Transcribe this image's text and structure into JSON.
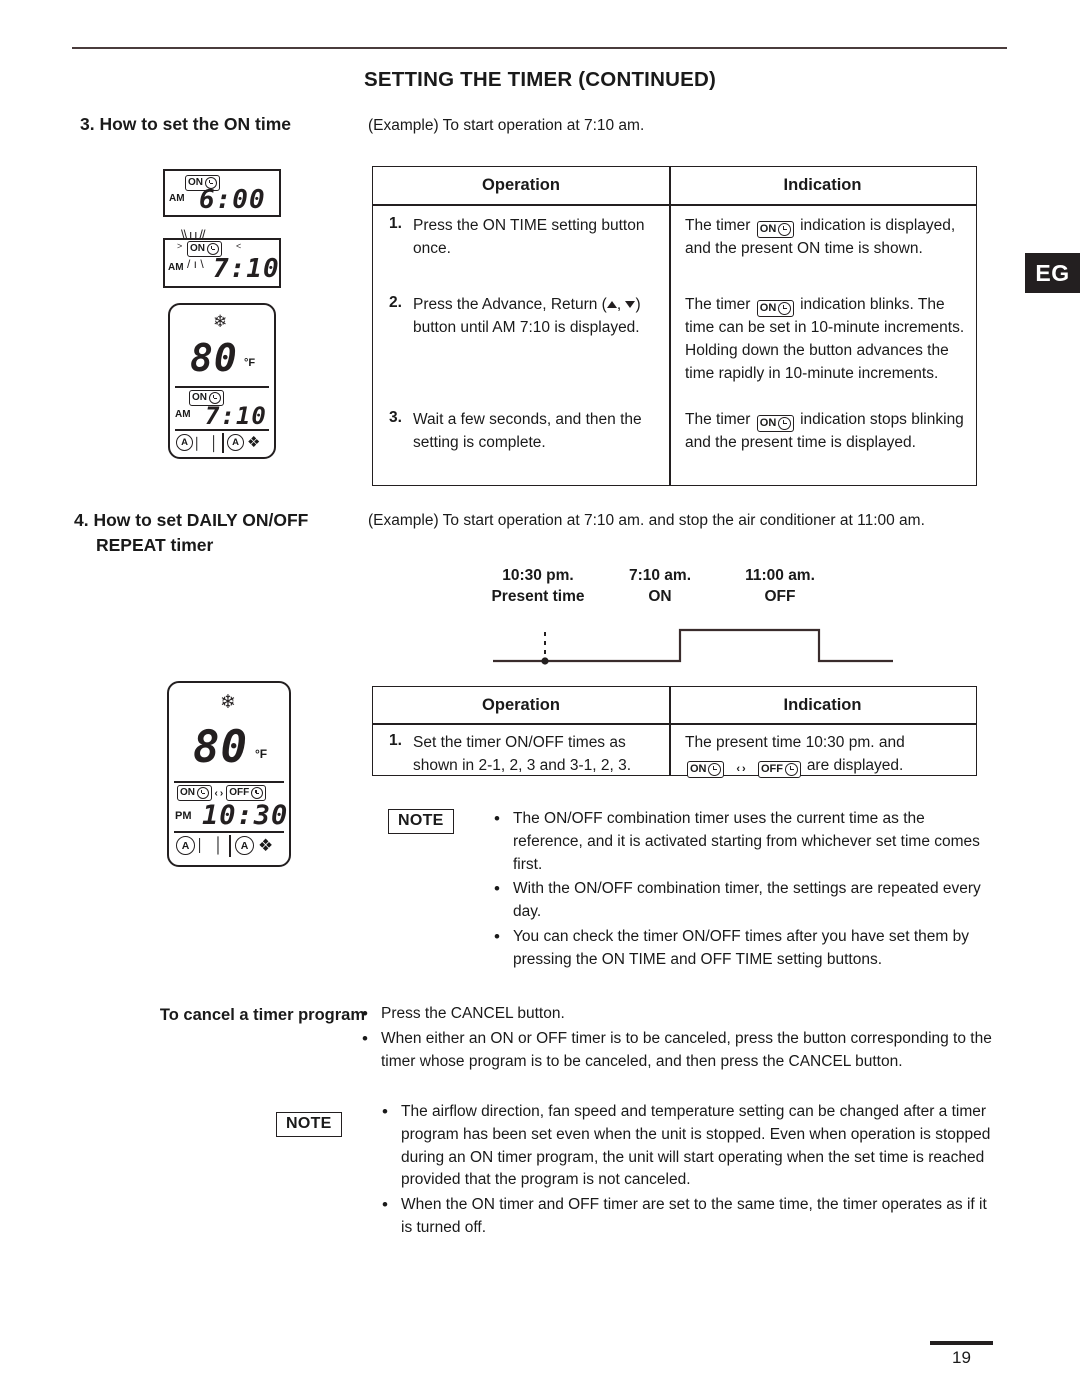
{
  "header": {
    "title": "SETTING THE TIMER (CONTINUED)",
    "edition_tab": "EG"
  },
  "footer": {
    "page_number": "19"
  },
  "section3": {
    "heading": "3. How to set the ON time",
    "example": "(Example) To start operation at 7:10 am.",
    "table": {
      "columns": [
        "Operation",
        "Indication"
      ],
      "rows": [
        {
          "number": "1.",
          "operation": "Press the ON TIME setting button once.",
          "indication_pre": "The timer",
          "indication_icon": "on-timer-icon",
          "indication_post": "indication is displayed, and the present ON time is shown."
        },
        {
          "number": "2.",
          "operation_pre": "Press the Advance, Return (",
          "operation_mid": ",",
          "operation_post": ") button until AM 7:10 is displayed.",
          "indication_pre": "The timer",
          "indication_icon": "on-timer-icon",
          "indication_post": "indication blinks. The time can be set in 10-minute increments. Holding down the button advances the time rapidly in 10-minute increments."
        },
        {
          "number": "3.",
          "operation": "Wait a few seconds, and then the setting is complete.",
          "indication_pre": "The timer",
          "indication_icon": "on-timer-icon",
          "indication_post": "indication stops blinking and the present time is displayed."
        }
      ]
    },
    "lcd_displays": [
      {
        "ampm": "AM",
        "time": "6:00",
        "badge": "ON",
        "blinking": false
      },
      {
        "ampm": "AM",
        "time": "7:10",
        "badge": "ON",
        "blinking": true
      },
      {
        "ampm": "AM",
        "time": "7:10",
        "badge": "ON",
        "temperature": "80",
        "unit": "°F",
        "mode_icon": "snowflake-icon",
        "louver": "auto",
        "fan": "auto"
      }
    ]
  },
  "section4": {
    "heading_line1": "4. How to set DAILY ON/OFF",
    "heading_line2": "REPEAT timer",
    "example": "(Example) To start operation at 7:10 am. and stop the air conditioner at 11:00 am.",
    "timeline": {
      "markers": [
        {
          "time": "10:30 pm.",
          "label": "Present time"
        },
        {
          "time": "7:10 am.",
          "label": "ON"
        },
        {
          "time": "11:00 am.",
          "label": "OFF"
        }
      ]
    },
    "table": {
      "columns": [
        "Operation",
        "Indication"
      ],
      "rows": [
        {
          "number": "1.",
          "operation": "Set the timer ON/OFF times as shown in 2-1, 2, 3 and 3-1, 2, 3.",
          "indication_pre": "The present time 10:30 pm. and",
          "indication_icons": [
            "on-timer-icon",
            "repeat-timer-icon",
            "off-timer-icon"
          ],
          "indication_post": "are displayed."
        }
      ]
    },
    "lcd_display": {
      "ampm": "PM",
      "time": "10:30",
      "temperature": "80",
      "unit": "°F",
      "mode_icon": "snowflake-icon",
      "badges": [
        "ON",
        "REPEAT",
        "OFF"
      ],
      "louver": "auto",
      "fan": "auto"
    },
    "note": {
      "label": "NOTE",
      "items": [
        "The ON/OFF combination timer uses the current time as the reference, and it is activated starting from whichever set time comes first.",
        "With the ON/OFF combination timer, the settings are repeated every day.",
        "You can check the timer ON/OFF times after you have set them by pressing the ON TIME and OFF TIME setting buttons."
      ]
    }
  },
  "cancel_section": {
    "heading": "To cancel a timer program",
    "items": [
      "Press the CANCEL button.",
      "When either an ON or OFF timer is to be canceled, press the button corresponding to the timer whose program is to be canceled, and then press the CANCEL button."
    ],
    "note": {
      "label": "NOTE",
      "items": [
        "The airflow direction, fan speed and temperature setting can be changed after a timer program has been set even when the unit is stopped. Even when operation is stopped during an ON timer program, the unit will start operating when the set time is reached provided that the program is not canceled.",
        "When the ON timer and OFF timer are set to the same time, the timer operates as if it is turned off."
      ]
    }
  },
  "colors": {
    "ink": "#231f20",
    "rule": "#4a3c3c",
    "tab_bg": "#231f20",
    "tab_text": "#ffffff"
  }
}
